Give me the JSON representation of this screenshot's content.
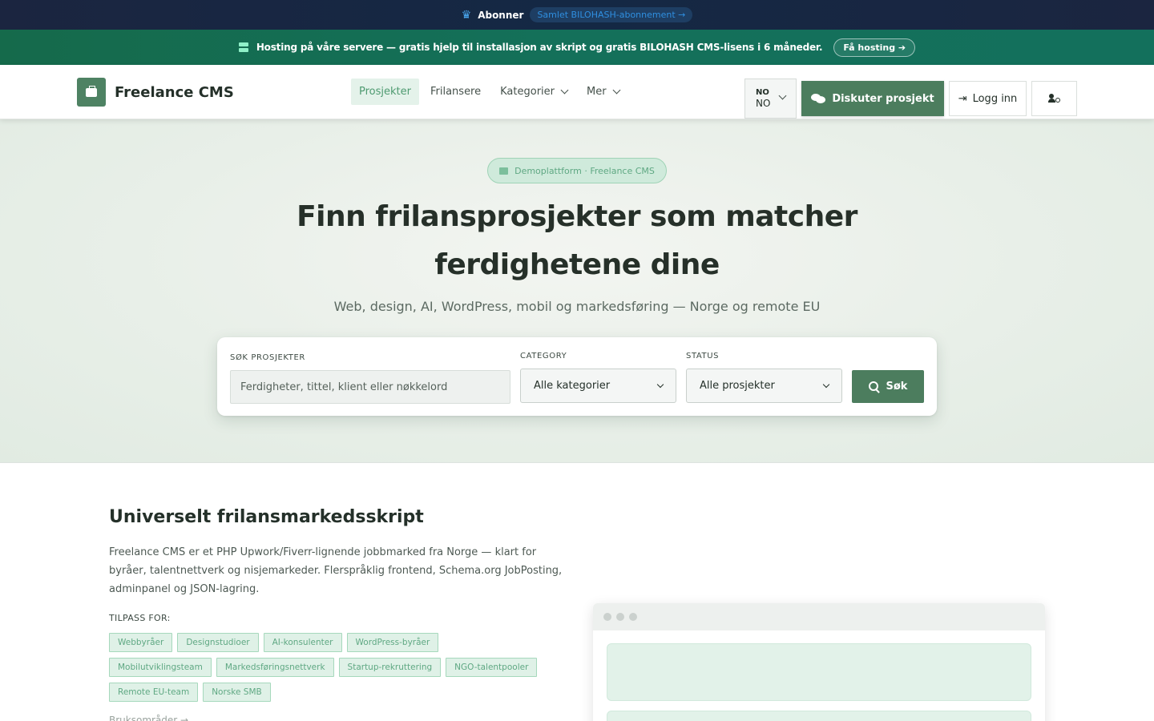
{
  "topbar": {
    "subscribe_label": "Abonner",
    "subscribe_pill": "Samlet BILOHASH-abonnement →",
    "crown_icon": "crown-icon"
  },
  "hostbar": {
    "text": "Hosting på våre servere — gratis hjelp til installasjon av skript og gratis BILOHASH CMS-lisens i 6 måneder.",
    "button": "Få hosting ➔",
    "icon": "server-icon"
  },
  "nav": {
    "brand": "Freelance CMS",
    "items": [
      {
        "label": "Prosjekter",
        "active": true
      },
      {
        "label": "Frilansere",
        "active": false
      },
      {
        "label": "Kategorier",
        "dropdown": true
      },
      {
        "label": "Mer",
        "dropdown": true
      }
    ],
    "lang_top": "NO",
    "lang_bottom": "NO",
    "discuss_label": "Diskuter prosjekt",
    "login_label": "Logg inn"
  },
  "hero": {
    "badge": "Demoplattform · Freelance CMS",
    "title_line1": "Finn frilansprosjekter som matcher",
    "title_line2": "ferdighetene dine",
    "subtitle": "Web, design, AI, WordPress, mobil og markedsføring — Norge og remote EU"
  },
  "search": {
    "search_label": "SØK PROSJEKTER",
    "search_placeholder": "Ferdigheter, tittel, klient eller nøkkelord",
    "category_label": "CATEGORY",
    "category_value": "Alle kategorier",
    "status_label": "STATUS",
    "status_value": "Alle prosjekter",
    "button": "Søk"
  },
  "section": {
    "title": "Universelt frilansmarkedsskript",
    "description": "Freelance CMS er et PHP Upwork/Fiverr-lignende jobbmarked fra Norge — klart for byråer, talentnettverk og nisjemarkeder. Flerspråklig frontend, Schema.org JobPosting, adminpanel og JSON-lagring.",
    "fit_label": "TILPASS FOR:",
    "tags": [
      "Webbyråer",
      "Designstudioer",
      "AI-konsulenter",
      "WordPress-byråer",
      "Mobilutviklingsteam",
      "Markedsføringsnettverk",
      "Startup-rekruttering",
      "NGO-talentpooler",
      "Remote EU-team",
      "Norske SMB"
    ],
    "bruk_label": "Bruksområder →"
  },
  "colors": {
    "primary_green": "#4c7d5e",
    "accent_green": "#5fa883",
    "topbar_navy": "#1b2540",
    "hostbar_teal": "#156a4b"
  }
}
